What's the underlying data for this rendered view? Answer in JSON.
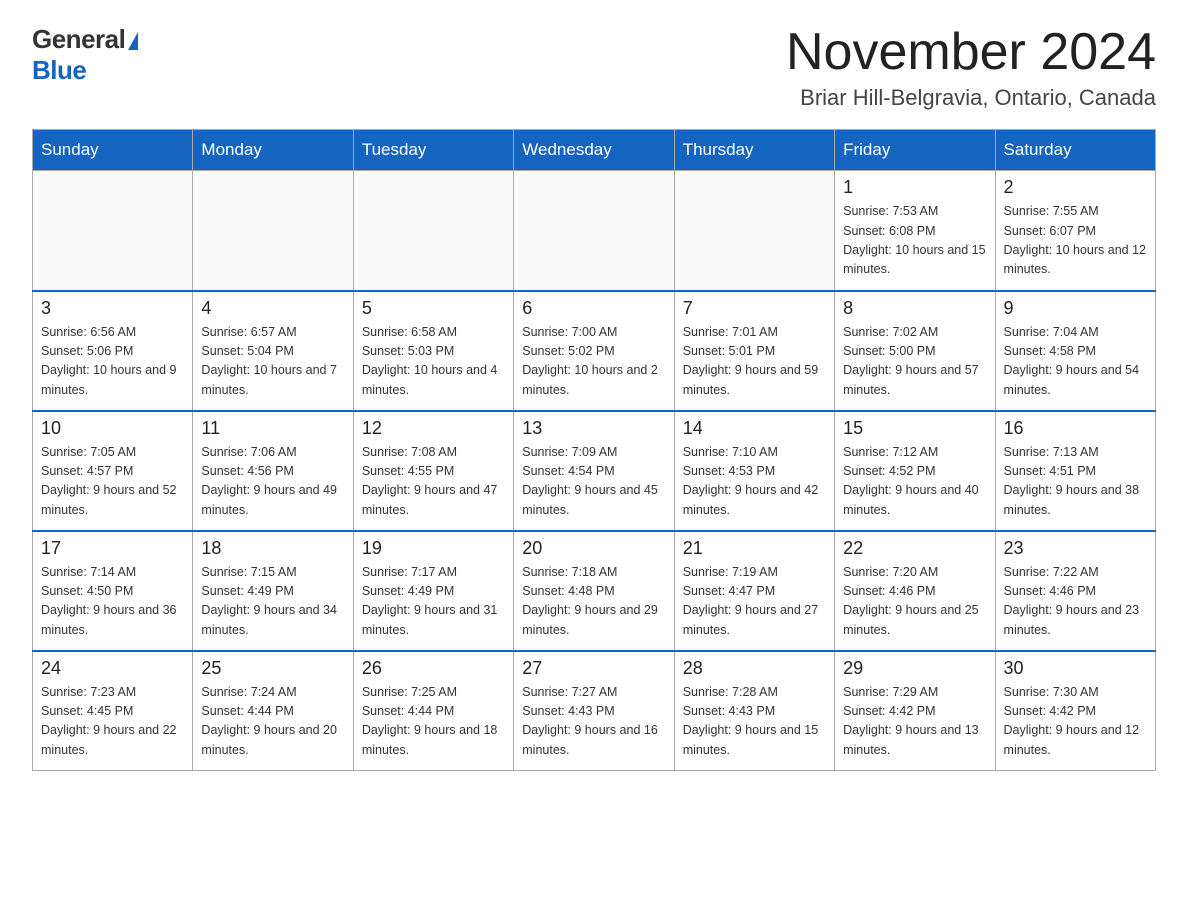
{
  "header": {
    "logo_general": "General",
    "logo_blue": "Blue",
    "month_title": "November 2024",
    "location": "Briar Hill-Belgravia, Ontario, Canada"
  },
  "weekdays": [
    "Sunday",
    "Monday",
    "Tuesday",
    "Wednesday",
    "Thursday",
    "Friday",
    "Saturday"
  ],
  "weeks": [
    [
      {
        "day": "",
        "sunrise": "",
        "sunset": "",
        "daylight": ""
      },
      {
        "day": "",
        "sunrise": "",
        "sunset": "",
        "daylight": ""
      },
      {
        "day": "",
        "sunrise": "",
        "sunset": "",
        "daylight": ""
      },
      {
        "day": "",
        "sunrise": "",
        "sunset": "",
        "daylight": ""
      },
      {
        "day": "",
        "sunrise": "",
        "sunset": "",
        "daylight": ""
      },
      {
        "day": "1",
        "sunrise": "Sunrise: 7:53 AM",
        "sunset": "Sunset: 6:08 PM",
        "daylight": "Daylight: 10 hours and 15 minutes."
      },
      {
        "day": "2",
        "sunrise": "Sunrise: 7:55 AM",
        "sunset": "Sunset: 6:07 PM",
        "daylight": "Daylight: 10 hours and 12 minutes."
      }
    ],
    [
      {
        "day": "3",
        "sunrise": "Sunrise: 6:56 AM",
        "sunset": "Sunset: 5:06 PM",
        "daylight": "Daylight: 10 hours and 9 minutes."
      },
      {
        "day": "4",
        "sunrise": "Sunrise: 6:57 AM",
        "sunset": "Sunset: 5:04 PM",
        "daylight": "Daylight: 10 hours and 7 minutes."
      },
      {
        "day": "5",
        "sunrise": "Sunrise: 6:58 AM",
        "sunset": "Sunset: 5:03 PM",
        "daylight": "Daylight: 10 hours and 4 minutes."
      },
      {
        "day": "6",
        "sunrise": "Sunrise: 7:00 AM",
        "sunset": "Sunset: 5:02 PM",
        "daylight": "Daylight: 10 hours and 2 minutes."
      },
      {
        "day": "7",
        "sunrise": "Sunrise: 7:01 AM",
        "sunset": "Sunset: 5:01 PM",
        "daylight": "Daylight: 9 hours and 59 minutes."
      },
      {
        "day": "8",
        "sunrise": "Sunrise: 7:02 AM",
        "sunset": "Sunset: 5:00 PM",
        "daylight": "Daylight: 9 hours and 57 minutes."
      },
      {
        "day": "9",
        "sunrise": "Sunrise: 7:04 AM",
        "sunset": "Sunset: 4:58 PM",
        "daylight": "Daylight: 9 hours and 54 minutes."
      }
    ],
    [
      {
        "day": "10",
        "sunrise": "Sunrise: 7:05 AM",
        "sunset": "Sunset: 4:57 PM",
        "daylight": "Daylight: 9 hours and 52 minutes."
      },
      {
        "day": "11",
        "sunrise": "Sunrise: 7:06 AM",
        "sunset": "Sunset: 4:56 PM",
        "daylight": "Daylight: 9 hours and 49 minutes."
      },
      {
        "day": "12",
        "sunrise": "Sunrise: 7:08 AM",
        "sunset": "Sunset: 4:55 PM",
        "daylight": "Daylight: 9 hours and 47 minutes."
      },
      {
        "day": "13",
        "sunrise": "Sunrise: 7:09 AM",
        "sunset": "Sunset: 4:54 PM",
        "daylight": "Daylight: 9 hours and 45 minutes."
      },
      {
        "day": "14",
        "sunrise": "Sunrise: 7:10 AM",
        "sunset": "Sunset: 4:53 PM",
        "daylight": "Daylight: 9 hours and 42 minutes."
      },
      {
        "day": "15",
        "sunrise": "Sunrise: 7:12 AM",
        "sunset": "Sunset: 4:52 PM",
        "daylight": "Daylight: 9 hours and 40 minutes."
      },
      {
        "day": "16",
        "sunrise": "Sunrise: 7:13 AM",
        "sunset": "Sunset: 4:51 PM",
        "daylight": "Daylight: 9 hours and 38 minutes."
      }
    ],
    [
      {
        "day": "17",
        "sunrise": "Sunrise: 7:14 AM",
        "sunset": "Sunset: 4:50 PM",
        "daylight": "Daylight: 9 hours and 36 minutes."
      },
      {
        "day": "18",
        "sunrise": "Sunrise: 7:15 AM",
        "sunset": "Sunset: 4:49 PM",
        "daylight": "Daylight: 9 hours and 34 minutes."
      },
      {
        "day": "19",
        "sunrise": "Sunrise: 7:17 AM",
        "sunset": "Sunset: 4:49 PM",
        "daylight": "Daylight: 9 hours and 31 minutes."
      },
      {
        "day": "20",
        "sunrise": "Sunrise: 7:18 AM",
        "sunset": "Sunset: 4:48 PM",
        "daylight": "Daylight: 9 hours and 29 minutes."
      },
      {
        "day": "21",
        "sunrise": "Sunrise: 7:19 AM",
        "sunset": "Sunset: 4:47 PM",
        "daylight": "Daylight: 9 hours and 27 minutes."
      },
      {
        "day": "22",
        "sunrise": "Sunrise: 7:20 AM",
        "sunset": "Sunset: 4:46 PM",
        "daylight": "Daylight: 9 hours and 25 minutes."
      },
      {
        "day": "23",
        "sunrise": "Sunrise: 7:22 AM",
        "sunset": "Sunset: 4:46 PM",
        "daylight": "Daylight: 9 hours and 23 minutes."
      }
    ],
    [
      {
        "day": "24",
        "sunrise": "Sunrise: 7:23 AM",
        "sunset": "Sunset: 4:45 PM",
        "daylight": "Daylight: 9 hours and 22 minutes."
      },
      {
        "day": "25",
        "sunrise": "Sunrise: 7:24 AM",
        "sunset": "Sunset: 4:44 PM",
        "daylight": "Daylight: 9 hours and 20 minutes."
      },
      {
        "day": "26",
        "sunrise": "Sunrise: 7:25 AM",
        "sunset": "Sunset: 4:44 PM",
        "daylight": "Daylight: 9 hours and 18 minutes."
      },
      {
        "day": "27",
        "sunrise": "Sunrise: 7:27 AM",
        "sunset": "Sunset: 4:43 PM",
        "daylight": "Daylight: 9 hours and 16 minutes."
      },
      {
        "day": "28",
        "sunrise": "Sunrise: 7:28 AM",
        "sunset": "Sunset: 4:43 PM",
        "daylight": "Daylight: 9 hours and 15 minutes."
      },
      {
        "day": "29",
        "sunrise": "Sunrise: 7:29 AM",
        "sunset": "Sunset: 4:42 PM",
        "daylight": "Daylight: 9 hours and 13 minutes."
      },
      {
        "day": "30",
        "sunrise": "Sunrise: 7:30 AM",
        "sunset": "Sunset: 4:42 PM",
        "daylight": "Daylight: 9 hours and 12 minutes."
      }
    ]
  ]
}
